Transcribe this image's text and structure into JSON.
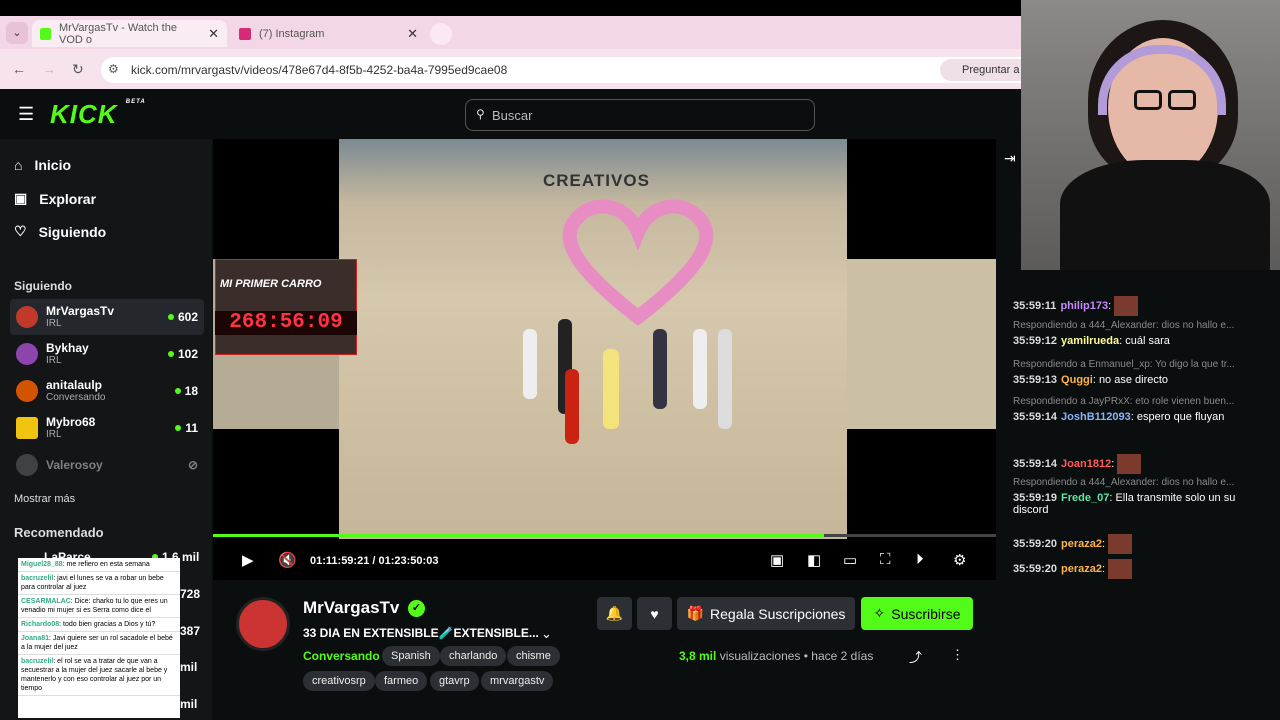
{
  "browser": {
    "tabs": [
      {
        "label": "MrVargasTv - Watch the VOD o",
        "color": "#53fc18"
      },
      {
        "label": "(7) Instagram",
        "color": "#d62976"
      }
    ],
    "url": "kick.com/mrvargastv/videos/478e67d4-8f5b-4252-ba4a-7995ed9cae08",
    "ask_label": "Preguntar a"
  },
  "header": {
    "logo": "KICK",
    "logo_badge": "BETA",
    "search_placeholder": "Buscar"
  },
  "sidebar": {
    "nav": [
      {
        "label": "Inicio",
        "icon": "home-icon"
      },
      {
        "label": "Explorar",
        "icon": "compass-icon"
      },
      {
        "label": "Siguiendo",
        "icon": "heart-icon"
      }
    ],
    "following_title": "Siguiendo",
    "following": [
      {
        "name": "MrVargasTv",
        "category": "IRL",
        "viewers": "602",
        "color": "#c0392b"
      },
      {
        "name": "Bykhay",
        "category": "IRL",
        "viewers": "102",
        "color": "#8e44ad"
      },
      {
        "name": "anitalaulp",
        "category": "Conversando",
        "viewers": "18",
        "color": "#d35400"
      },
      {
        "name": "Mybro68",
        "category": "IRL",
        "viewers": "11",
        "color": "#f1c40f"
      }
    ],
    "offline": "Valerosoy",
    "show_more": "Mostrar más",
    "recommended_title": "Recomendado",
    "recommended": [
      {
        "name": "LaParce",
        "viewers": "1,6 mil"
      },
      {
        "name": "",
        "viewers": "728"
      },
      {
        "name": "",
        "viewers": "387"
      },
      {
        "name": "",
        "viewers": "mil"
      },
      {
        "name": "",
        "viewers": "mil"
      }
    ]
  },
  "video": {
    "overlay_brand": "CREATIVOS",
    "cam_label": "MI PRIMER CARRO",
    "timer": "268:56:09",
    "time_current": "01:11:59:21",
    "time_total": "01:23:50:03",
    "progress": 0.78
  },
  "channel": {
    "name": "MrVargasTv",
    "title": "33 DIA EN EXTENSIBLE🧪EXTENSIBLE...",
    "category": "Conversando",
    "tags_row1": [
      "Spanish",
      "charlando",
      "chisme"
    ],
    "tags_row2": [
      "creativosrp",
      "farmeo",
      "gtavrp",
      "mrvargastv"
    ],
    "gift_label": "Regala Suscripciones",
    "subscribe_label": "Suscribirse",
    "views": "3,8 mil",
    "views_label": "visualizaciones",
    "ago": "hace 2 días"
  },
  "popup_chat": [
    {
      "user": "Miguel28_88",
      "text": ": me refiero en esta semana"
    },
    {
      "user": "bacruzelil",
      "text": ": javi el lunes se va a robar un bebe para controlar al juez"
    },
    {
      "user": "CESARMALAC",
      "text": ": Dice: charko tu lo que eres un venadio mi mujer si es Serra como dice el"
    },
    {
      "user": "Richardo08",
      "text": ": todo bien gracias a Dios y tú?"
    },
    {
      "user": "Joana81",
      "text": ": Javi quiere ser un rol sacadole el bebé a la mujer del juez"
    },
    {
      "user": "bacruzelil",
      "text": ": el rol se va a tratar de que van a secuestrar a la mujer del juez sacarle al bebe y mantenerlo y con eso controlar al juez por un tiempo"
    }
  ],
  "chat": [
    {
      "reply": "",
      "time": "35:59:11",
      "user": "philip173",
      "color": "#c58af9",
      "text": ":"
    },
    {
      "reply": "Respondiendo a 444_Alexander: dios no hallo e...",
      "time": "35:59:12",
      "user": "yamilrueda",
      "color": "#fdfd96",
      "text": ": cuál sara"
    },
    {
      "reply": "Respondiendo a Enmanuel_xp: Yo digo la que tr...",
      "time": "35:59:13",
      "user": "Quggi",
      "color": "#ffb347",
      "text": ": no ase directo"
    },
    {
      "reply": "Respondiendo a JayPRxX: eto role vienen buen...",
      "time": "35:59:14",
      "user": "JoshB112093",
      "color": "#8ab4f8",
      "text": ": espero que fluyan"
    },
    {
      "reply": "",
      "time": "35:59:14",
      "user": "Joan1812",
      "color": "#ff5c5c",
      "text": ":"
    },
    {
      "reply": "Respondiendo a 444_Alexander: dios no hallo e...",
      "time": "35:59:19",
      "user": "Frede_07",
      "color": "#5ee6a0",
      "text": ": Ella transmite solo un su discord"
    },
    {
      "reply": "",
      "time": "35:59:20",
      "user": "peraza2",
      "color": "#ffb347",
      "text": ":"
    },
    {
      "reply": "",
      "time": "35:59:20",
      "user": "peraza2",
      "color": "#ffb347",
      "text": ":"
    }
  ]
}
